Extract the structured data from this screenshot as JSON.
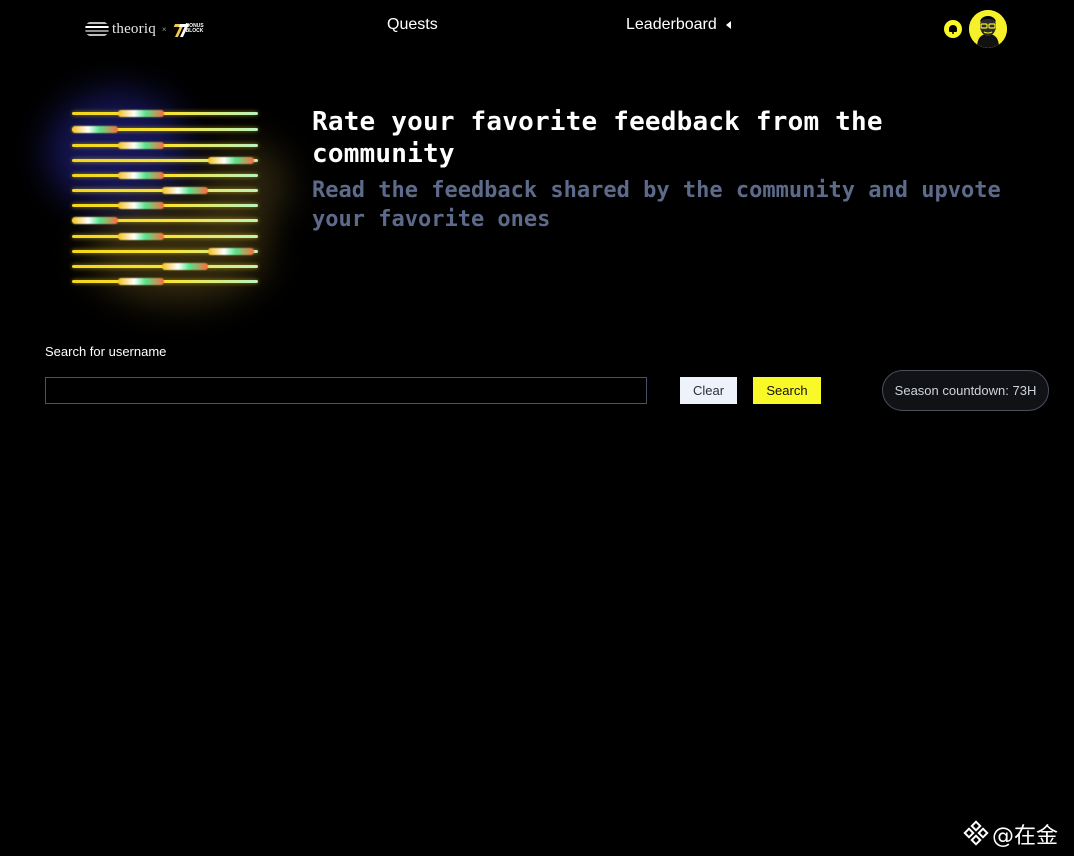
{
  "nav": {
    "brand": {
      "name": "theoriq",
      "separator": "×",
      "partner": "BONUS BLOCK"
    },
    "links": {
      "quests": "Quests",
      "leaderboard": "Leaderboard"
    },
    "icons": {
      "notifications": "bell-icon",
      "leaderboard_caret": "caret-left-icon"
    }
  },
  "hero": {
    "title": "Rate your favorite feedback from the community",
    "subtitle": "Read the feedback shared by the community and upvote your favorite ones"
  },
  "search": {
    "label": "Search for username",
    "value": "",
    "clear_label": "Clear",
    "search_label": "Search"
  },
  "season": {
    "countdown": "Season countdown: 73H"
  },
  "watermark": {
    "text": "@在金"
  },
  "colors": {
    "background": "#000000",
    "accent_yellow": "#f9f928",
    "subtitle": "#5d6a8a",
    "clear_button": "#eef2fb",
    "input_border": "#4a5066"
  }
}
